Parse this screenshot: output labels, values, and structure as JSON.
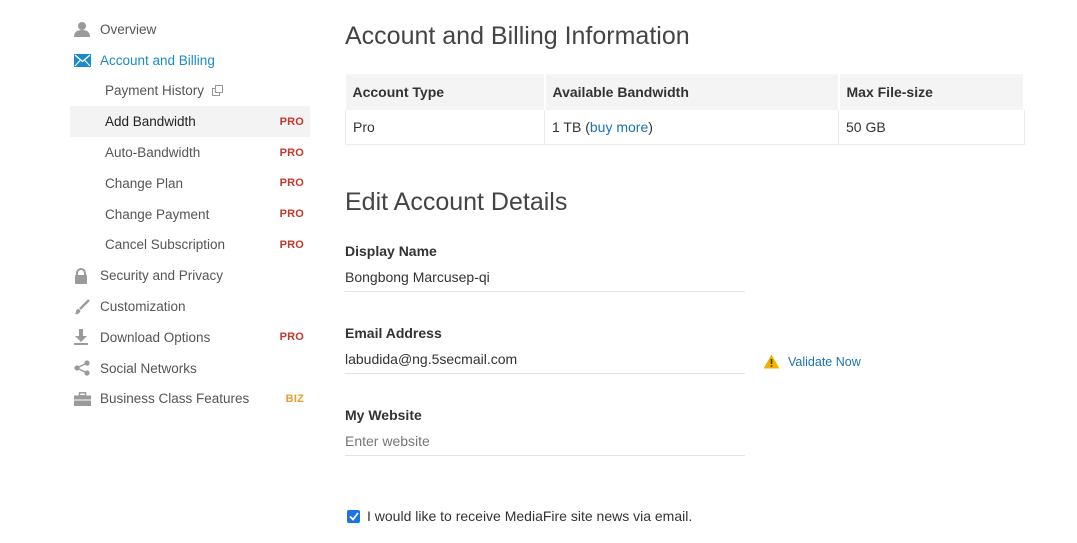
{
  "sidebar": {
    "items": [
      {
        "label": "Overview",
        "icon": "user-icon"
      },
      {
        "label": "Account and Billing",
        "icon": "envelope-icon"
      },
      {
        "label": "Payment History",
        "icon": "external-link-icon"
      },
      {
        "label": "Add Bandwidth",
        "badge": "PRO"
      },
      {
        "label": "Auto-Bandwidth",
        "badge": "PRO"
      },
      {
        "label": "Change Plan",
        "badge": "PRO"
      },
      {
        "label": "Change Payment",
        "badge": "PRO"
      },
      {
        "label": "Cancel Subscription",
        "badge": "PRO"
      },
      {
        "label": "Security and Privacy",
        "icon": "lock-icon"
      },
      {
        "label": "Customization",
        "icon": "brush-icon"
      },
      {
        "label": "Download Options",
        "icon": "download-icon",
        "badge": "PRO"
      },
      {
        "label": "Social Networks",
        "icon": "share-icon"
      },
      {
        "label": "Business Class Features",
        "icon": "briefcase-icon",
        "badge": "BIZ"
      }
    ]
  },
  "main": {
    "title": "Account and Billing Information",
    "table": {
      "headers": [
        "Account Type",
        "Available Bandwidth",
        "Max File-size"
      ],
      "row": {
        "account_type": "Pro",
        "bandwidth_prefix": "1 TB (",
        "bandwidth_link": "buy more",
        "bandwidth_suffix": ")",
        "max_file_size": "50 GB"
      }
    },
    "edit_title": "Edit Account Details",
    "display_name": {
      "label": "Display Name",
      "value": "Bongbong Marcusep-qi"
    },
    "email": {
      "label": "Email Address",
      "value": "labudida@ng.5secmail.com",
      "validate_label": "Validate Now"
    },
    "website": {
      "label": "My Website",
      "value": "",
      "placeholder": "Enter website"
    },
    "newsletter": {
      "label": "I would like to receive MediaFire site news via email.",
      "checked": true
    }
  },
  "colors": {
    "accent": "#1a8acb",
    "pro_badge": "#c0392b",
    "biz_badge": "#e0a030",
    "warning": "#f0b400"
  }
}
